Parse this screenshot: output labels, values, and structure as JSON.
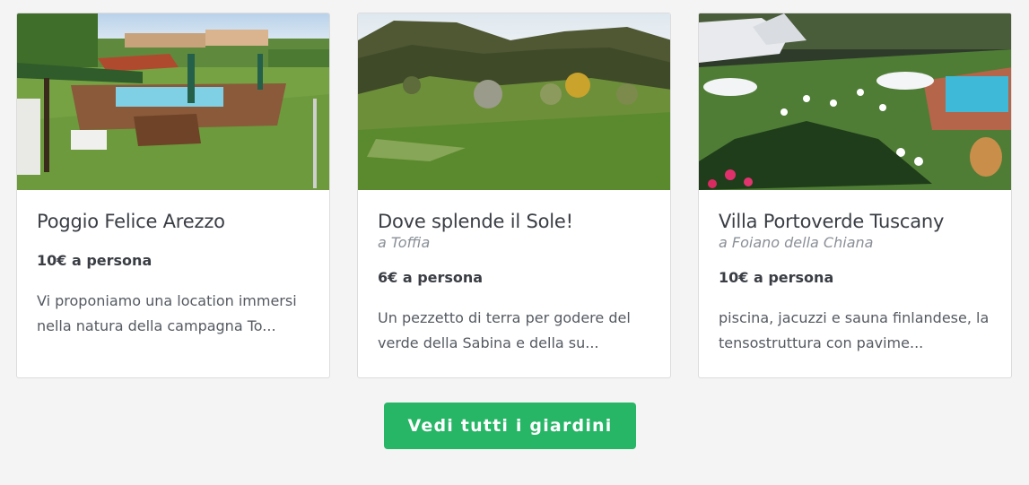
{
  "cards": [
    {
      "title": "Poggio Felice Arezzo",
      "location": "",
      "price": "10€ a persona",
      "description": "Vi proponiamo una location immersi nella natura della campagna To..."
    },
    {
      "title": "Dove splende il Sole!",
      "location": "a Toffia",
      "price": "6€ a persona",
      "description": "Un pezzetto di terra per godere del verde della Sabina e della su..."
    },
    {
      "title": "Villa Portoverde Tuscany",
      "location": "a Foiano della Chiana",
      "price": "10€ a persona",
      "description": "piscina, jacuzzi e sauna finlandese, la tensostruttura con pavime..."
    }
  ],
  "cta": {
    "label": "Vedi tutti i giardini"
  },
  "colors": {
    "background": "#f4f4f4",
    "cta": "#27b566",
    "location": "#8b9097"
  }
}
